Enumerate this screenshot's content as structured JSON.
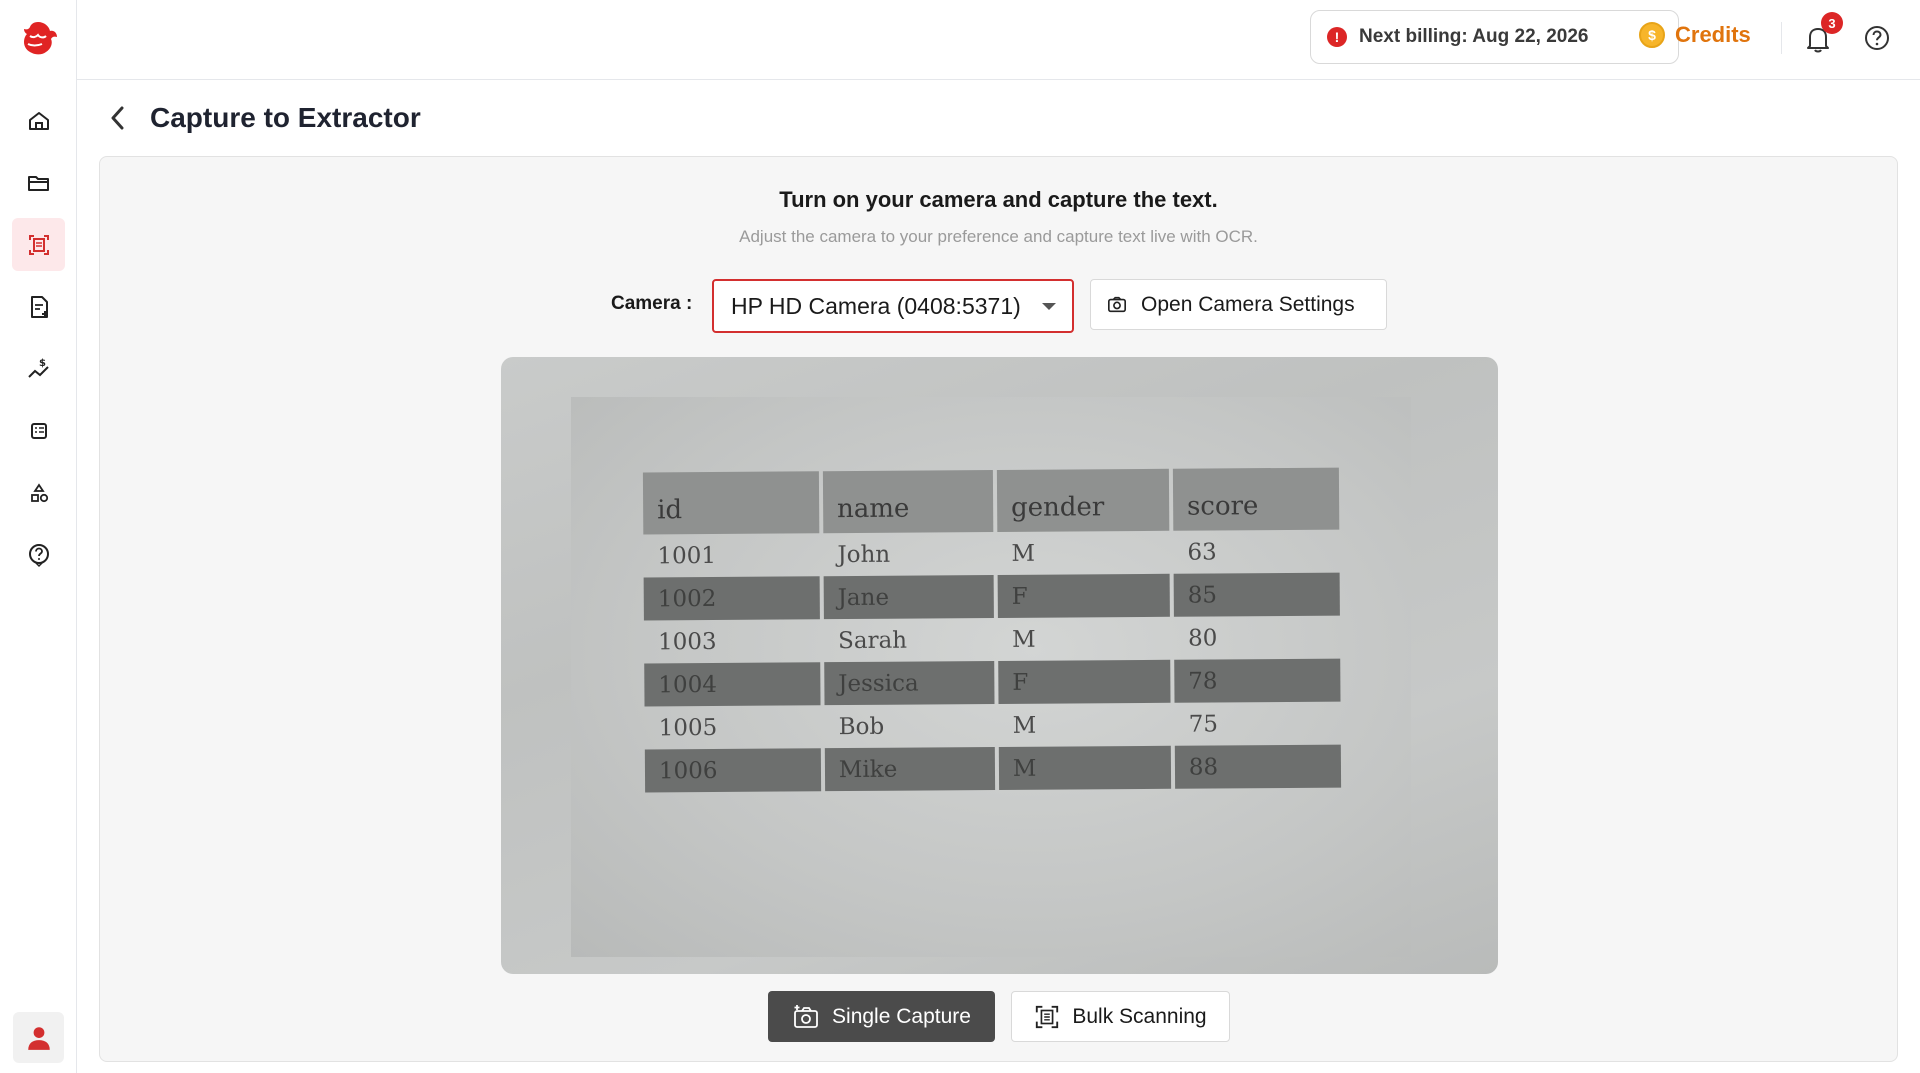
{
  "topbar": {
    "billing_label": "Next billing: Aug 22, 2026",
    "credits_label": "Credits",
    "coin_symbol": "$",
    "notification_count": "3"
  },
  "sidebar": {
    "items": [
      {
        "icon": "home-icon"
      },
      {
        "icon": "folder-icon"
      },
      {
        "icon": "scan-icon",
        "active": true
      },
      {
        "icon": "document-add-icon"
      },
      {
        "icon": "pricing-graph-icon"
      },
      {
        "icon": "list-icon"
      },
      {
        "icon": "shapes-icon"
      },
      {
        "icon": "help-icon"
      }
    ],
    "accent": "#d32f2f"
  },
  "page": {
    "title": "Capture to Extractor"
  },
  "panel": {
    "heading": "Turn on your camera and capture the text.",
    "subheading": "Adjust the camera to your preference and capture text live with OCR.",
    "camera_label": "Camera :",
    "camera_selected": "HP HD Camera (0408:5371)",
    "camera_settings_label": "Open Camera Settings",
    "single_capture_label": "Single Capture",
    "bulk_scanning_label": "Bulk Scanning"
  },
  "preview_table": {
    "headers": [
      "id",
      "name",
      "gender",
      "score"
    ],
    "rows": [
      [
        "1001",
        "John",
        "M",
        "63"
      ],
      [
        "1002",
        "Jane",
        "F",
        "85"
      ],
      [
        "1003",
        "Sarah",
        "M",
        "80"
      ],
      [
        "1004",
        "Jessica",
        "F",
        "78"
      ],
      [
        "1005",
        "Bob",
        "M",
        "75"
      ],
      [
        "1006",
        "Mike",
        "M",
        "88"
      ]
    ]
  }
}
